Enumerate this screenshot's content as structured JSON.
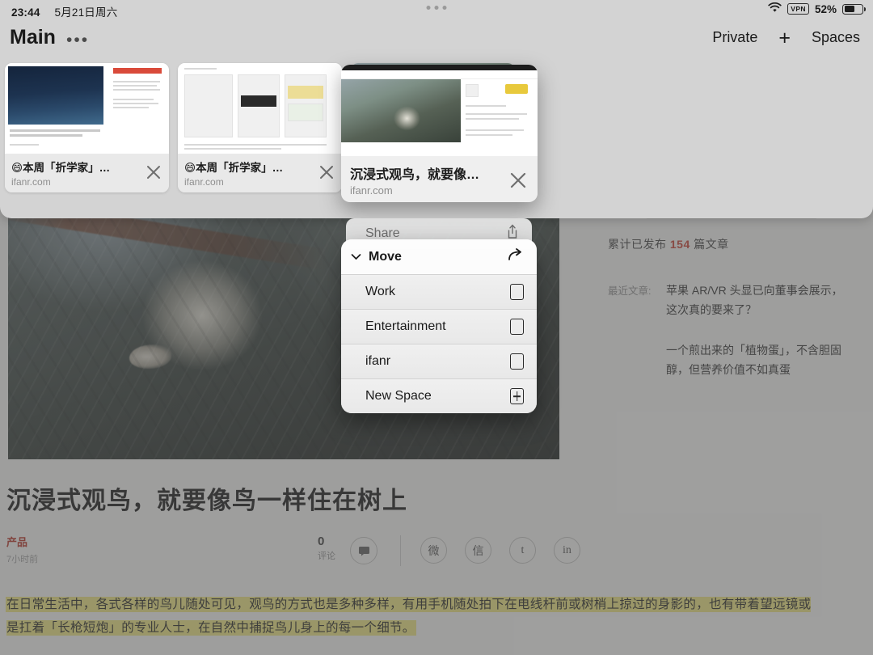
{
  "status_bar": {
    "time": "23:44",
    "date": "5月21日周六",
    "wifi_icon": "wifi-icon",
    "vpn_label": "VPN",
    "battery_percent": "52%"
  },
  "toolbar": {
    "space_title": "Main",
    "more_label": "•••",
    "private_label": "Private",
    "new_tab_label": "+",
    "spaces_label": "Spaces"
  },
  "tabs": [
    {
      "title": "😄本周「折学家」…",
      "url": "ifanr.com",
      "close_label": "×"
    },
    {
      "title": "😄本周「折学家」…",
      "url": "ifanr.com",
      "close_label": "×"
    },
    {
      "title": "沉浸式观鸟，就要像…",
      "url": "ifanr.com",
      "close_label": "×"
    }
  ],
  "dragged_tab": {
    "title": "沉浸式观鸟，就要像…",
    "url": "ifanr.com",
    "close_label": "×"
  },
  "context_menu": {
    "share_label": "Share",
    "share_icon": "share-icon",
    "move_label": "Move",
    "move_icon": "arrow-forward-icon",
    "chevron_icon": "chevron-down-icon",
    "spaces": [
      {
        "label": "Work",
        "icon": "empty-checkbox-icon"
      },
      {
        "label": "Entertainment",
        "icon": "empty-checkbox-icon"
      },
      {
        "label": "ifanr",
        "icon": "empty-checkbox-icon"
      }
    ],
    "new_space_label": "New Space",
    "new_space_icon": "plus-box-icon"
  },
  "article": {
    "title": "沉浸式观鸟，就要像鸟一样住在树上",
    "category": "产品",
    "time_ago": "7小时前",
    "comment_count": "0",
    "comment_label": "评论",
    "comment_icon": "comment-icon",
    "share_buttons": [
      {
        "name": "weibo",
        "glyph": "微"
      },
      {
        "name": "wechat",
        "glyph": "信"
      },
      {
        "name": "twitter",
        "glyph": "t"
      },
      {
        "name": "linkedin",
        "glyph": "in"
      }
    ],
    "body_highlighted": "在日常生活中，各式各样的鸟儿随处可见，观鸟的方式也是多种多样，有用手机随处拍下在电线杆前或树梢上掠过的身影的，也有带着望远镜或是扛着「长枪短炮」的专业人士，在自然中捕捉鸟儿身上的每一个细节。"
  },
  "sidebar": {
    "published_prefix": "累计已发布",
    "published_count": "154",
    "published_suffix": "篇文章",
    "recent_label": "最近文章:",
    "recent_articles": [
      "苹果 AR/VR 头显已向董事会展示，这次真的要来了？",
      "一个煎出来的「植物蛋」，不含胆固醇，但营养价值不如真蛋"
    ]
  },
  "colors": {
    "accent_red": "#c0392b",
    "highlight_yellow": "#e8e07a",
    "panel_gray": "#d3d3d3"
  }
}
